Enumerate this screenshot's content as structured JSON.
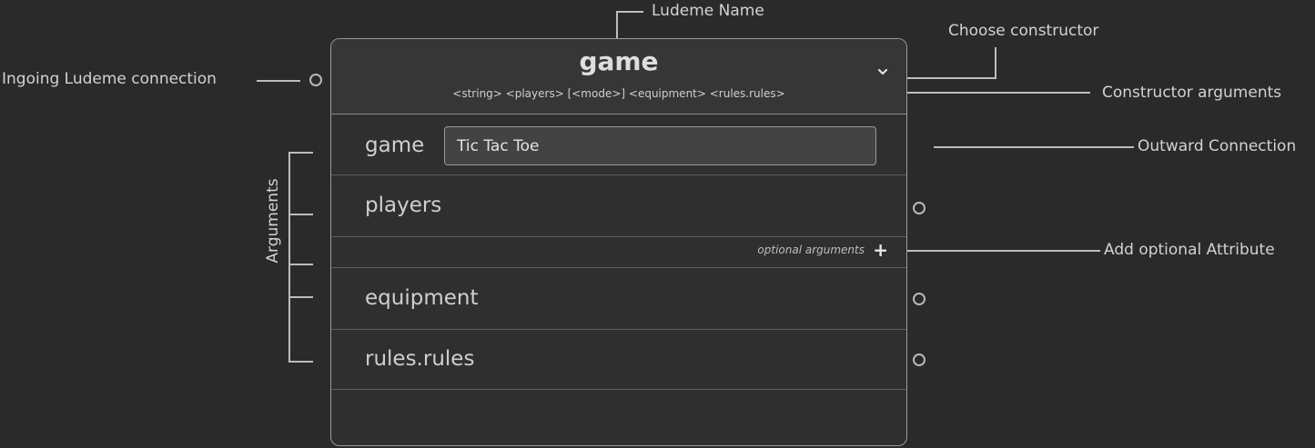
{
  "annotations": {
    "ludeme_name": "Ludeme Name",
    "choose_constructor": "Choose constructor",
    "ingoing_connection": "Ingoing Ludeme connection",
    "constructor_arguments": "Constructor arguments",
    "outward_connection": "Outward Connection",
    "arguments": "Arguments",
    "add_optional_attribute": "Add optional Attribute"
  },
  "node": {
    "title": "game",
    "signature": "<string> <players> [<mode>] <equipment> <rules.rules>",
    "constructor_icon": "chevron-down-icon",
    "rows": [
      {
        "label": "game",
        "input_value": "Tic Tac Toe"
      },
      {
        "label": "players"
      },
      {
        "optional_label": "optional arguments",
        "add_icon": "plus-icon",
        "add_symbol": "+"
      },
      {
        "label": "equipment"
      },
      {
        "label": "rules.rules"
      }
    ]
  },
  "colors": {
    "background": "#2a2a2a",
    "node_body": "#2f2f2f",
    "node_header": "#363636",
    "input_bg": "#434343",
    "border": "#9a9a9a",
    "text": "#d6d6d6"
  }
}
